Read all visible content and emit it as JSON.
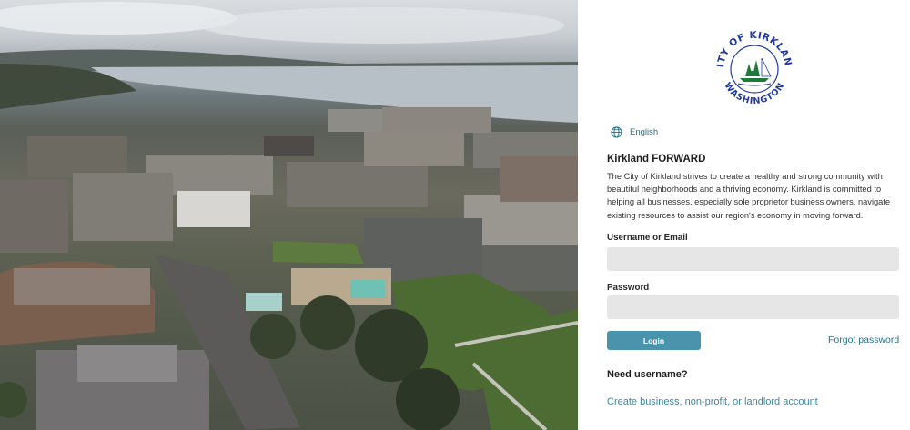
{
  "hero": {
    "description_icon": "aerial-city-photo"
  },
  "seal": {
    "top_text": "CITY OF KIRKLAND",
    "bottom_text": "WASHINGTON",
    "colors": {
      "text": "#1f3aa0",
      "green": "#1e7a3a"
    }
  },
  "language": {
    "icon": "globe-icon",
    "label": "English"
  },
  "intro": {
    "title": "Kirkland FORWARD",
    "body": "The City of Kirkland strives to create a healthy and strong community with beautiful neighborhoods and a thriving economy. Kirkland is committed to helping all businesses, especially sole proprietor business owners, navigate existing resources to assist our region's economy in moving forward."
  },
  "form": {
    "username_label": "Username or Email",
    "username_value": "",
    "password_label": "Password",
    "password_value": "",
    "login_label": "Login",
    "forgot_label": "Forgot password"
  },
  "signup": {
    "heading": "Need username?",
    "link_label": "Create business, non-profit, or landlord account"
  },
  "colors": {
    "accent": "#4a93ad",
    "link": "#2b6f89",
    "field_bg": "#e6e6e6"
  }
}
